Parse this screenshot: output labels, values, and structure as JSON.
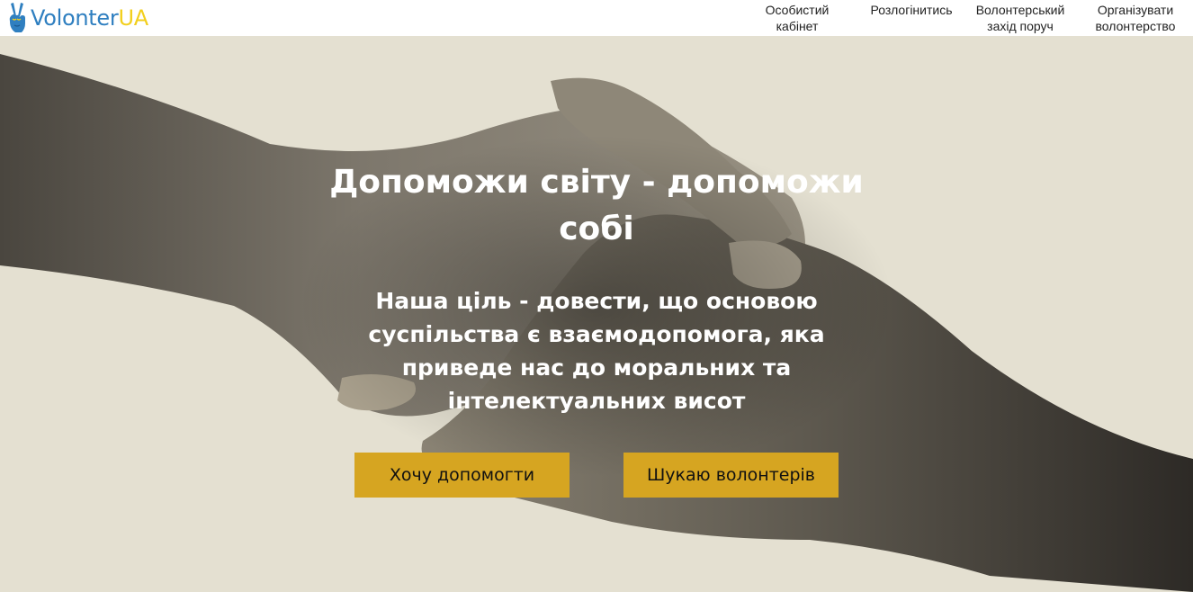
{
  "logo": {
    "text_main": "Volonter",
    "text_accent": "UA",
    "icon": "victory-hand-icon",
    "colors": {
      "main": "#2f7fc0",
      "accent": "#f2cf1d"
    }
  },
  "nav": {
    "items": [
      {
        "label": "Особистий кабінет"
      },
      {
        "label": "Розлогінитись"
      },
      {
        "label": "Волонтерський захід поруч"
      },
      {
        "label": "Організувати волонтерство"
      }
    ]
  },
  "hero": {
    "title": "Допоможи світу - допоможи собі",
    "subtitle": "Наша ціль - довести, що основою суспільства є взаємодопомога, яка приведе нас до моральних та інтелектуальних висот",
    "background_image": "handshake-photo",
    "buttons": {
      "help": "Хочу допомогти",
      "find": "Шукаю волонтерів"
    },
    "colors": {
      "button": "#d6a521",
      "background": "#e4e0d1"
    }
  }
}
